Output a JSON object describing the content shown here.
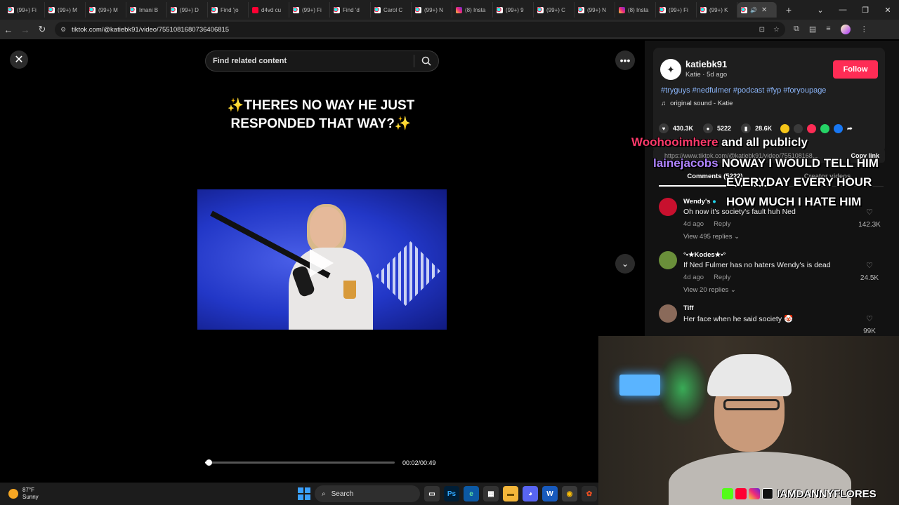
{
  "browser": {
    "tabs": [
      {
        "label": "(99+) Fi",
        "icon": "tiktok-icon"
      },
      {
        "label": "(99+) M",
        "icon": "tiktok-icon"
      },
      {
        "label": "(99+) M",
        "icon": "tiktok-icon"
      },
      {
        "label": "Imani B",
        "icon": "tiktok-icon"
      },
      {
        "label": "(99+) D",
        "icon": "tiktok-icon"
      },
      {
        "label": "Find 'jo",
        "icon": "tiktok-icon"
      },
      {
        "label": "d4vd cu",
        "icon": "youtube-icon"
      },
      {
        "label": "(99+) Fi",
        "icon": "tiktok-icon"
      },
      {
        "label": "Find 'd",
        "icon": "tiktok-icon"
      },
      {
        "label": "Carol C",
        "icon": "tiktok-icon"
      },
      {
        "label": "(99+) N",
        "icon": "tiktok-icon"
      },
      {
        "label": "(8) Insta",
        "icon": "instagram-icon"
      },
      {
        "label": "(99+) 9",
        "icon": "tiktok-icon"
      },
      {
        "label": "(99+) C",
        "icon": "tiktok-icon"
      },
      {
        "label": "(99+) N",
        "icon": "tiktok-icon"
      },
      {
        "label": "(8) Insta",
        "icon": "instagram-icon"
      },
      {
        "label": "(99+) Fi",
        "icon": "tiktok-icon"
      },
      {
        "label": "(99+) K",
        "icon": "tiktok-icon"
      }
    ],
    "url": "tiktok.com/@katiebk91/video/7551081680736406815"
  },
  "video": {
    "search_placeholder": "Find related content",
    "caption": "✨THERES NO WAY HE JUST RESPONDED THAT WAY?✨",
    "progress": 0.02,
    "timecode": "00:02/00:49"
  },
  "author": {
    "username": "katiebk91",
    "subline": "Katie · 5d ago",
    "follow_label": "Follow",
    "hashtags": "#tryguys #nedfulmer #podcast #fyp #foryoupage",
    "sound": "original sound - Katie",
    "likes": "430.3K",
    "comments": "5222",
    "saves": "28.6K",
    "link": "https://www.tiktok.com/@katiebk91/video/755108168...",
    "copy_label": "Copy link"
  },
  "comment_tabs": {
    "comments": "Comments (5222)",
    "creator": "Creator videos"
  },
  "comments": [
    {
      "name": "Wendy's",
      "text": "Oh now it's society's fault huh Ned",
      "time": "4d ago",
      "reply": "Reply",
      "replies": "View 495 replies",
      "likes": "142.3K"
    },
    {
      "name": "°•★Kodes★•°",
      "text": "If Ned Fulmer has no haters Wendy's is dead",
      "time": "4d ago",
      "reply": "Reply",
      "replies": "View 20 replies",
      "likes": "24.5K"
    },
    {
      "name": "Tiff",
      "text": "Her face when he said society 🤡",
      "likes": "99K"
    }
  ],
  "overlay": {
    "line1_user": "Woohooimhere",
    "line1_msg": "and all publicly",
    "line2_user": "lainejacobs",
    "line2_msg": "NOWAY I WOULD TELL HIM",
    "line3_msg": "EVERYDAY EVERY HOUR",
    "line4_msg": "HOW MUCH I HATE HIM"
  },
  "webcam": {
    "handle": "IAMDANNYFLORES"
  },
  "taskbar": {
    "temp": "87°F",
    "condition": "Sunny",
    "search": "Search"
  },
  "colors": {
    "follow": "#fe2c55",
    "hashtag": "#8ab4f8"
  }
}
